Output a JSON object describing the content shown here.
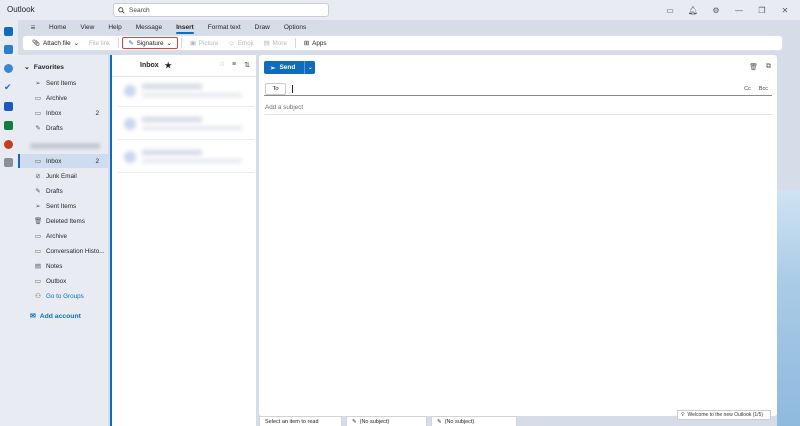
{
  "app": {
    "title": "Outlook"
  },
  "search": {
    "placeholder": "Search"
  },
  "ribbon_tabs": [
    "Home",
    "View",
    "Help",
    "Message",
    "Insert",
    "Format text",
    "Draw",
    "Options"
  ],
  "active_tab": "Insert",
  "ribbon": {
    "attach_file": "Attach file",
    "file_link": "File link",
    "signature": "Signature",
    "picture": "Picture",
    "emoji": "Emoji",
    "more": "More",
    "apps": "Apps"
  },
  "folders": {
    "favorites_label": "Favorites",
    "favorites": [
      {
        "label": "Sent Items",
        "icon": "send-icon"
      },
      {
        "label": "Archive",
        "icon": "archive-icon"
      },
      {
        "label": "Inbox",
        "icon": "inbox-icon",
        "count": "2"
      },
      {
        "label": "Drafts",
        "icon": "pencil-icon"
      }
    ],
    "account_items": [
      {
        "label": "Inbox",
        "icon": "inbox-icon",
        "count": "2",
        "selected": true
      },
      {
        "label": "Junk Email",
        "icon": "junk-icon"
      },
      {
        "label": "Drafts",
        "icon": "pencil-icon"
      },
      {
        "label": "Sent Items",
        "icon": "send-icon"
      },
      {
        "label": "Deleted Items",
        "icon": "trash-icon"
      },
      {
        "label": "Archive",
        "icon": "archive-icon"
      },
      {
        "label": "Conversation Histo...",
        "icon": "folder-icon"
      },
      {
        "label": "Notes",
        "icon": "note-icon"
      },
      {
        "label": "Outbox",
        "icon": "outbox-icon"
      }
    ],
    "go_to_groups": "Go to Groups",
    "add_account": "Add account"
  },
  "mail_list": {
    "title": "Inbox"
  },
  "compose": {
    "send": "Send",
    "to": "To",
    "cc": "Cc",
    "bcc": "Bcc",
    "subject_placeholder": "Add a subject"
  },
  "bottom_tabs": [
    "Select an item to read",
    "(No subject)",
    "(No subject)"
  ],
  "toast": "Welcome to the new Outlook (1/5)",
  "colors": {
    "accent": "#0f6cbd",
    "highlight_border": "#e04040"
  }
}
